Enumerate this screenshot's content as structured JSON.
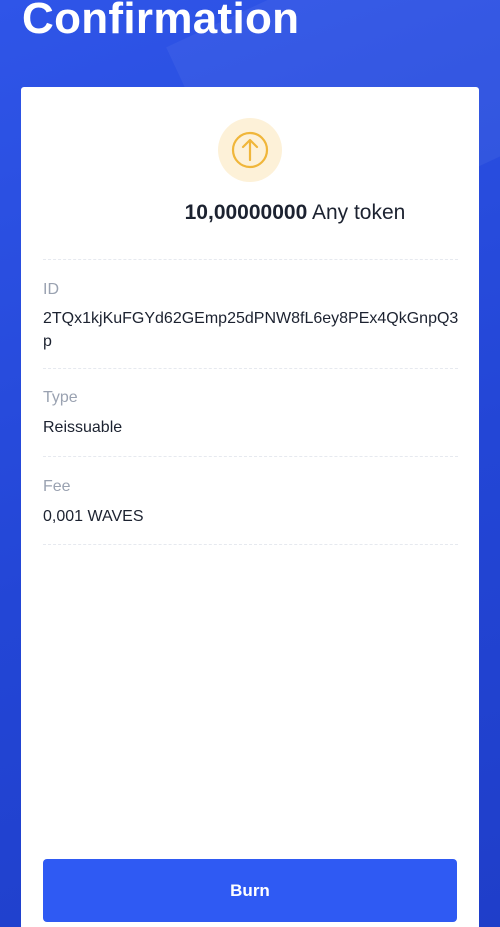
{
  "header": {
    "title": "Confirmation"
  },
  "token": {
    "icon": "arrow-up-circle-icon",
    "icon_color": "#f0b63a",
    "amount": "10,00000000",
    "name": "Any token"
  },
  "details": {
    "id_label": "ID",
    "id_value": "2TQx1kjKuFGYd62GEmp25dPNW8fL6ey8PEx4QkGnpQ3p",
    "type_label": "Type",
    "type_value": "Reissuable",
    "fee_label": "Fee",
    "fee_value": "0,001 WAVES"
  },
  "actions": {
    "burn_label": "Burn"
  },
  "colors": {
    "background": "#2346d6",
    "accent": "#2f5af3",
    "icon_bg": "#fdf1d8"
  }
}
